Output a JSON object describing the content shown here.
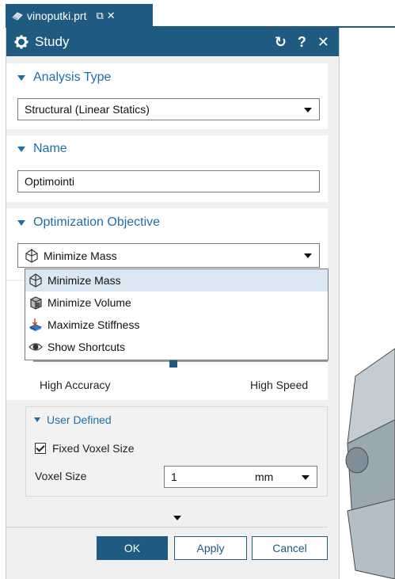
{
  "file_tab": {
    "name": "vinoputki.prt",
    "pin_glyph": "⧉",
    "close_glyph": "✕"
  },
  "dialog": {
    "title": "Study",
    "reset_glyph": "↻",
    "help_glyph": "?",
    "close_glyph": "✕"
  },
  "analysis_type": {
    "header": "Analysis Type",
    "value": "Structural (Linear Statics)"
  },
  "name_group": {
    "header": "Name",
    "value": "Optimointi"
  },
  "objective": {
    "header": "Optimization Objective",
    "value": "Minimize Mass",
    "options": [
      {
        "label": "Minimize Mass",
        "icon": "minimize-mass-icon"
      },
      {
        "label": "Minimize Volume",
        "icon": "minimize-volume-icon"
      },
      {
        "label": "Maximize Stiffness",
        "icon": "maximize-stiffness-icon"
      },
      {
        "label": "Show Shortcuts",
        "icon": "eye-icon"
      }
    ],
    "selected_index": 0
  },
  "accuracy": {
    "left_label": "High Accuracy",
    "right_label": "High Speed",
    "position": 0.5
  },
  "user_defined": {
    "header": "User Defined",
    "fixed_voxel_label": "Fixed Voxel Size",
    "fixed_voxel_checked": true,
    "voxel_size_label": "Voxel Size",
    "voxel_size_value": "1",
    "voxel_size_unit": "mm"
  },
  "buttons": {
    "ok": "OK",
    "apply": "Apply",
    "cancel": "Cancel"
  },
  "colors": {
    "accent": "#1f5a80",
    "header_text": "#1f6fa5",
    "selected_row": "#dbe8f3"
  }
}
